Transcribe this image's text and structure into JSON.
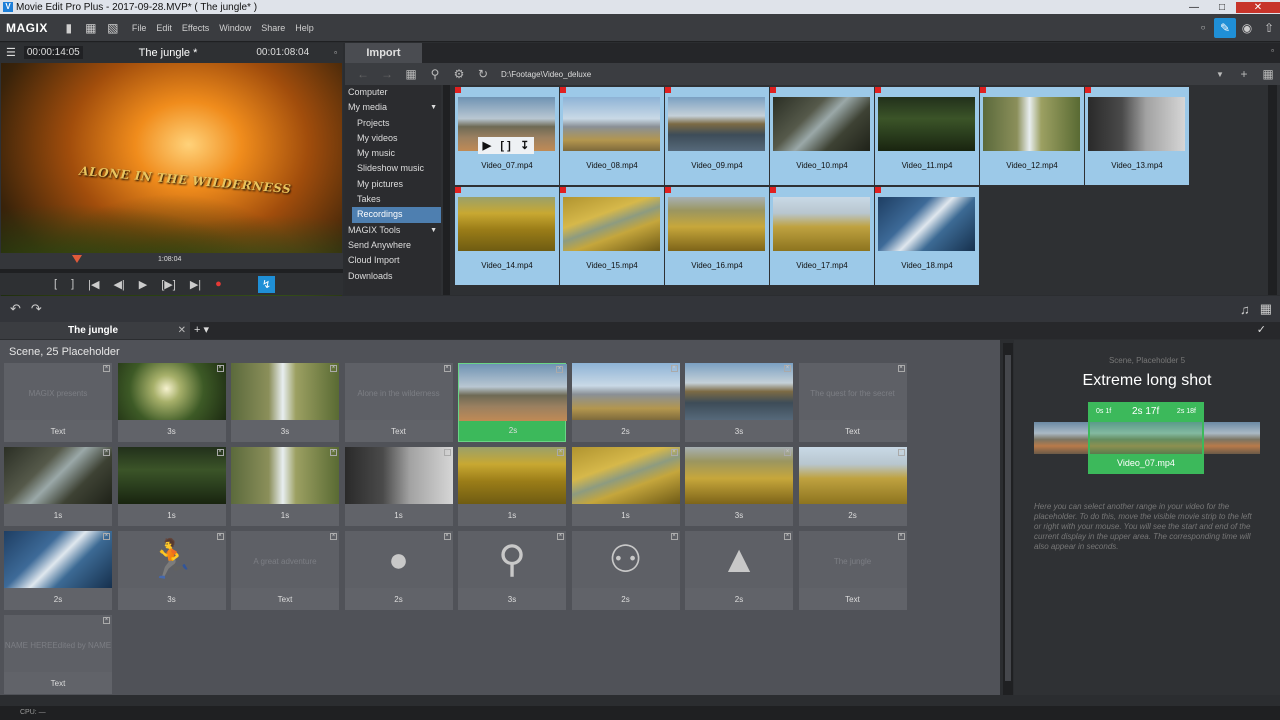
{
  "window": {
    "title": "Movie Edit Pro Plus - 2017-09-28.MVP* ( The jungle* )"
  },
  "menubar": {
    "logo": "MAGIX",
    "items": [
      "File",
      "Edit",
      "Effects",
      "Window",
      "Share",
      "Help"
    ]
  },
  "preview": {
    "timecode_left": "00:00:14:05",
    "title": "The jungle *",
    "timecode_right": "00:01:08:04",
    "video_caption": "ALONE IN THE WILDERNESS",
    "position_label": "1:08:04"
  },
  "import": {
    "tab": "Import",
    "path": "D:\\Footage\\Video_deluxe",
    "tree": [
      {
        "label": "Computer",
        "level": 0
      },
      {
        "label": "My media",
        "level": 0,
        "arrow": true
      },
      {
        "label": "Projects",
        "level": 1
      },
      {
        "label": "My videos",
        "level": 1
      },
      {
        "label": "My music",
        "level": 1
      },
      {
        "label": "Slideshow music",
        "level": 1
      },
      {
        "label": "My pictures",
        "level": 1
      },
      {
        "label": "Takes",
        "level": 1
      },
      {
        "label": "Recordings",
        "level": 1,
        "selected": true
      },
      {
        "label": "MAGIX Tools",
        "level": 0,
        "arrow": true
      },
      {
        "label": "Send Anywhere",
        "level": 0
      },
      {
        "label": "Cloud Import",
        "level": 0
      },
      {
        "label": "Downloads",
        "level": 0
      }
    ],
    "clips": [
      {
        "name": "Video_07.mp4",
        "theme": "lake"
      },
      {
        "name": "Video_08.mp4",
        "theme": "plane"
      },
      {
        "name": "Video_09.mp4",
        "theme": "lake2"
      },
      {
        "name": "Video_10.mp4",
        "theme": "cliff"
      },
      {
        "name": "Video_11.mp4",
        "theme": "forest"
      },
      {
        "name": "Video_12.mp4",
        "theme": "waterfall"
      },
      {
        "name": "Video_13.mp4",
        "theme": "camera"
      },
      {
        "name": "Video_14.mp4",
        "theme": "yellow"
      },
      {
        "name": "Video_15.mp4",
        "theme": "yellow2"
      },
      {
        "name": "Video_16.mp4",
        "theme": "yellow3"
      },
      {
        "name": "Video_17.mp4",
        "theme": "yellow4"
      },
      {
        "name": "Video_18.mp4",
        "theme": "blue"
      }
    ]
  },
  "scenes": {
    "tab": "The jungle",
    "title": "Scene, 25 Placeholder",
    "cards": [
      {
        "label": "Text",
        "text": "MAGIX presents"
      },
      {
        "label": "3s",
        "theme": "forestlight"
      },
      {
        "label": "3s",
        "theme": "waterfall"
      },
      {
        "label": "Text",
        "text": "Alone in the wilderness"
      },
      {
        "label": "2s",
        "theme": "lake",
        "selected": true
      },
      {
        "label": "2s",
        "theme": "plane"
      },
      {
        "label": "3s",
        "theme": "lake2"
      },
      {
        "label": "Text",
        "text": "The quest for the secret"
      },
      {
        "label": "1s",
        "theme": "cliff"
      },
      {
        "label": "1s",
        "theme": "forest"
      },
      {
        "label": "1s",
        "theme": "waterfall"
      },
      {
        "label": "1s",
        "theme": "camera"
      },
      {
        "label": "1s",
        "theme": "yellow"
      },
      {
        "label": "1s",
        "theme": "yellow2"
      },
      {
        "label": "3s",
        "theme": "yellow3"
      },
      {
        "label": "2s",
        "theme": "yellow4"
      },
      {
        "label": "2s",
        "theme": "blue"
      },
      {
        "label": "3s",
        "icon": "runner"
      },
      {
        "label": "Text",
        "text": "A great adventure"
      },
      {
        "label": "2s",
        "icon": "person"
      },
      {
        "label": "3s",
        "icon": "magnifier"
      },
      {
        "label": "2s",
        "icon": "group"
      },
      {
        "label": "2s",
        "icon": "tree"
      },
      {
        "label": "Text",
        "text": "The jungle"
      },
      {
        "label": "Text",
        "text": "NAME HEREEdited by    NAME"
      }
    ]
  },
  "detail": {
    "subtitle": "Scene, Placeholder 5",
    "title": "Extreme long shot",
    "start": "0s 1f",
    "duration": "2s 17f",
    "end": "2s 18f",
    "clip": "Video_07.mp4",
    "help": "Here you can select another range in your video for the placeholder. To do this, move the visible movie strip to the left or right with your mouse. You will see the start and end of the current display in the upper area. The corresponding time will also appear in seconds."
  },
  "status": {
    "cpu": "CPU: —"
  }
}
